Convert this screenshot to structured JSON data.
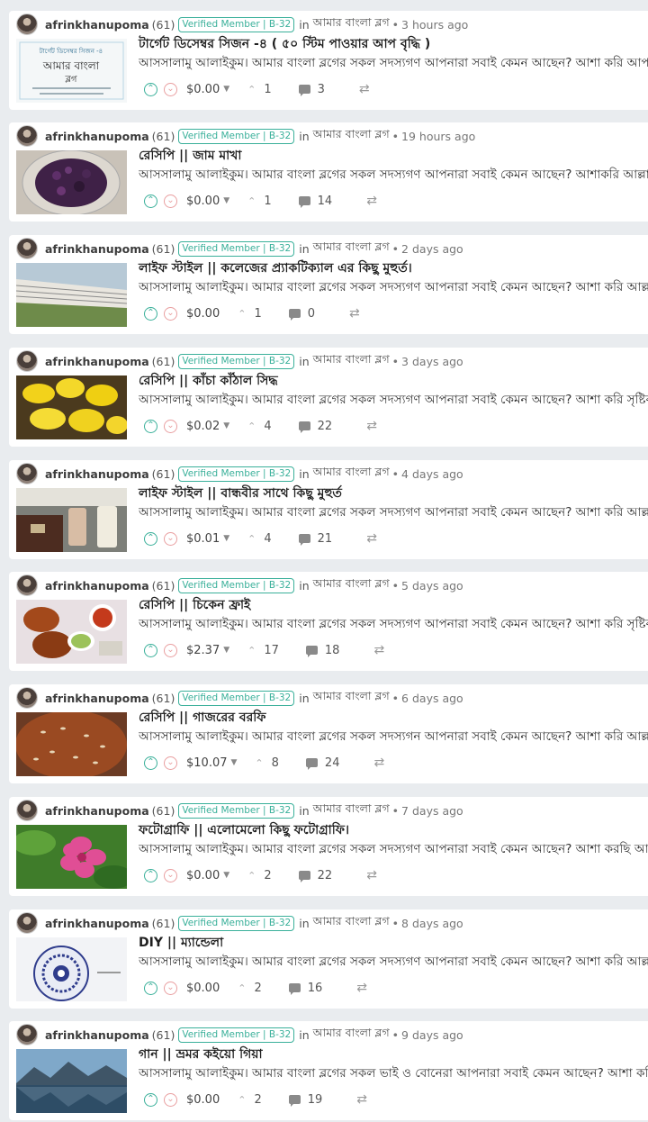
{
  "author": "afrinkhanupoma",
  "reputation": "(61)",
  "badge": "Verified Member | B-32",
  "in_word": "in",
  "community": "আমার বাংলা ব্লগ",
  "posts": [
    {
      "time": "3 hours ago",
      "title": "টার্গেট ডিসেম্বর সিজন -৪ ( ৫০ স্টিম পাওয়ার আপ বৃদ্ধি )",
      "excerpt": "আসসালামু আলাইকুম। আমার বাংলা ব্লগের সকল সদস্যগণ আপনারা সবাই কেমন আছেন? আশা করি আপনারা",
      "payout": "$0.00",
      "payout_caret": true,
      "votes": "1",
      "comments": "3",
      "thumb": "target-poster",
      "thumb_text": [
        "টার্গেট ডিসেম্বর সিজন -৪",
        "আমার বাংলা",
        "ব্লগ"
      ]
    },
    {
      "time": "19 hours ago",
      "title": "রেসিপি || জাম মাখা",
      "excerpt": "আসসালামু আলাইকুম। আমার বাংলা ব্লগের সকল সদস্যগণ আপনারা সবাই কেমন আছেন? আশাকরি আল্লাহর",
      "payout": "$0.00",
      "payout_caret": true,
      "votes": "1",
      "comments": "14",
      "thumb": "jam-plate"
    },
    {
      "time": "2 days ago",
      "title": "লাইফ স্টাইল || কলেজের প্র্যাকটিক্যাল এর কিছু মুহুর্ত।",
      "excerpt": "আসসালামু আলাইকুম। আমার বাংলা ব্লগের সকল সদস্যগণ আপনারা সবাই কেমন আছেন? আশা করি আল্লাহর",
      "payout": "$0.00",
      "payout_caret": false,
      "votes": "1",
      "comments": "0",
      "thumb": "college"
    },
    {
      "time": "3 days ago",
      "title": "রেসিপি || কাঁচা কাঁঠাল সিদ্ধ",
      "excerpt": "আসসালামু আলাইকুম। আমার বাংলা ব্লগের সকল সদস্যগণ আপনারা সবাই কেমন আছেন? আশা করি সৃষ্টিকর্তার",
      "payout": "$0.02",
      "payout_caret": true,
      "votes": "4",
      "comments": "22",
      "thumb": "jackfruit"
    },
    {
      "time": "4 days ago",
      "title": "লাইফ স্টাইল || বান্ধবীর সাথে কিছু মুহুর্ত",
      "excerpt": "আসসালামু আলাইকুম। আমার বাংলা ব্লগের সকল সদস্যগণ আপনারা সবাই কেমন আছেন? আশা করি আল্লাহর",
      "payout": "$0.01",
      "payout_caret": true,
      "votes": "4",
      "comments": "21",
      "thumb": "drinks"
    },
    {
      "time": "5 days ago",
      "title": "রেসিপি || চিকেন ফ্রাই",
      "excerpt": "আসসালামু আলাইকুম। আমার বাংলা ব্লগের সকল সদস্যগণ আপনারা সবাই কেমন আছেন? আশা করি সৃষ্টিকর্তার",
      "payout": "$2.37",
      "payout_caret": true,
      "votes": "17",
      "comments": "18",
      "thumb": "chicken"
    },
    {
      "time": "6 days ago",
      "title": "রেসিপি || গাজরের বরফি",
      "excerpt": "আসসালামু আলাইকুম। আমার বাংলা ব্লগের সকল সদস্যগন আপনারা সবাই কেমন আছেন? আশা করি আল্লাহর",
      "payout": "$10.07",
      "payout_caret": true,
      "votes": "8",
      "comments": "24",
      "thumb": "barfi"
    },
    {
      "time": "7 days ago",
      "title": "ফটোগ্রাফি || এলোমেলো কিছু ফটোগ্রাফি।",
      "excerpt": "আসসালামু আলাইকুম। আমার বাংলা ব্লগের সকল সদস্যগণ আপনারা সবাই কেমন আছেন? আশা করছি আপনারা",
      "payout": "$0.00",
      "payout_caret": true,
      "votes": "2",
      "comments": "22",
      "thumb": "flower"
    },
    {
      "time": "8 days ago",
      "title": "DIY || ম্যান্ডেলা",
      "excerpt": "আসসালামু আলাইকুম। আমার বাংলা ব্লগের সকল সদস্যগণ আপনারা সবাই কেমন আছেন? আশা করি আল্লাহর",
      "payout": "$0.00",
      "payout_caret": false,
      "votes": "2",
      "comments": "16",
      "thumb": "mandala"
    },
    {
      "time": "9 days ago",
      "title": "গান || ভ্রমর কইয়ো গিয়া",
      "excerpt": "আসসালামু আলাইকুম। আমার বাংলা ব্লগের সকল ভাই ও বোনেরা আপনারা সবাই কেমন আছেন? আশা করি",
      "payout": "$0.00",
      "payout_caret": false,
      "votes": "2",
      "comments": "19",
      "thumb": "lake"
    }
  ]
}
